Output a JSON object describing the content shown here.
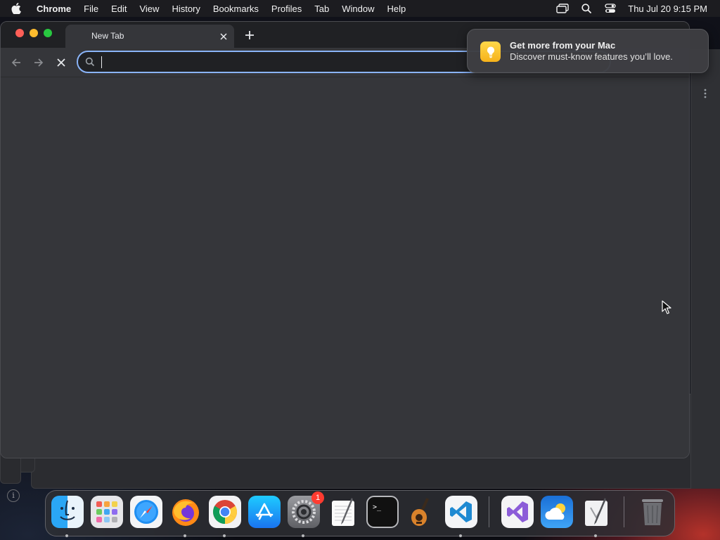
{
  "menubar": {
    "app_name": "Chrome",
    "items": [
      "File",
      "Edit",
      "View",
      "History",
      "Bookmarks",
      "Profiles",
      "Tab",
      "Window",
      "Help"
    ],
    "icons": [
      "screen-mirroring-icon",
      "spotlight-search-icon",
      "control-center-icon"
    ],
    "clock": "Thu Jul 20  9:15 PM"
  },
  "browser": {
    "tab_title": "New Tab",
    "omnibox_value": "",
    "traffic_lights": {
      "close": "#ff5f57",
      "minimize": "#febc2e",
      "zoom": "#28c840"
    },
    "accent": "#8ab4f8"
  },
  "notification": {
    "title": "Get more from your Mac",
    "body": "Discover must-know features you’ll love."
  },
  "dock": {
    "items": [
      {
        "name": "Finder",
        "icon": "finder-icon",
        "running": true
      },
      {
        "name": "Launchpad",
        "icon": "launchpad-icon",
        "running": false
      },
      {
        "name": "Safari",
        "icon": "safari-icon",
        "running": false
      },
      {
        "name": "Firefox",
        "icon": "firefox-icon",
        "running": true
      },
      {
        "name": "Google Chrome",
        "icon": "chrome-icon",
        "running": true
      },
      {
        "name": "App Store",
        "icon": "app-store-icon",
        "running": false
      },
      {
        "name": "System Settings",
        "icon": "system-settings-icon",
        "running": true,
        "badge": "1"
      },
      {
        "name": "TextEdit",
        "icon": "textedit-icon",
        "running": false
      },
      {
        "name": "Terminal",
        "icon": "terminal-icon",
        "running": false
      },
      {
        "name": "GarageBand",
        "icon": "garageband-icon",
        "running": false
      },
      {
        "name": "Visual Studio Code",
        "icon": "vscode-icon",
        "running": true
      },
      {
        "name": "Visual Studio",
        "icon": "visual-studio-icon",
        "running": false
      },
      {
        "name": "Weather",
        "icon": "weather-icon",
        "running": false
      },
      {
        "name": "Script Editor",
        "icon": "script-editor-icon",
        "running": true
      },
      {
        "name": "Trash",
        "icon": "trash-icon",
        "running": false
      }
    ]
  }
}
